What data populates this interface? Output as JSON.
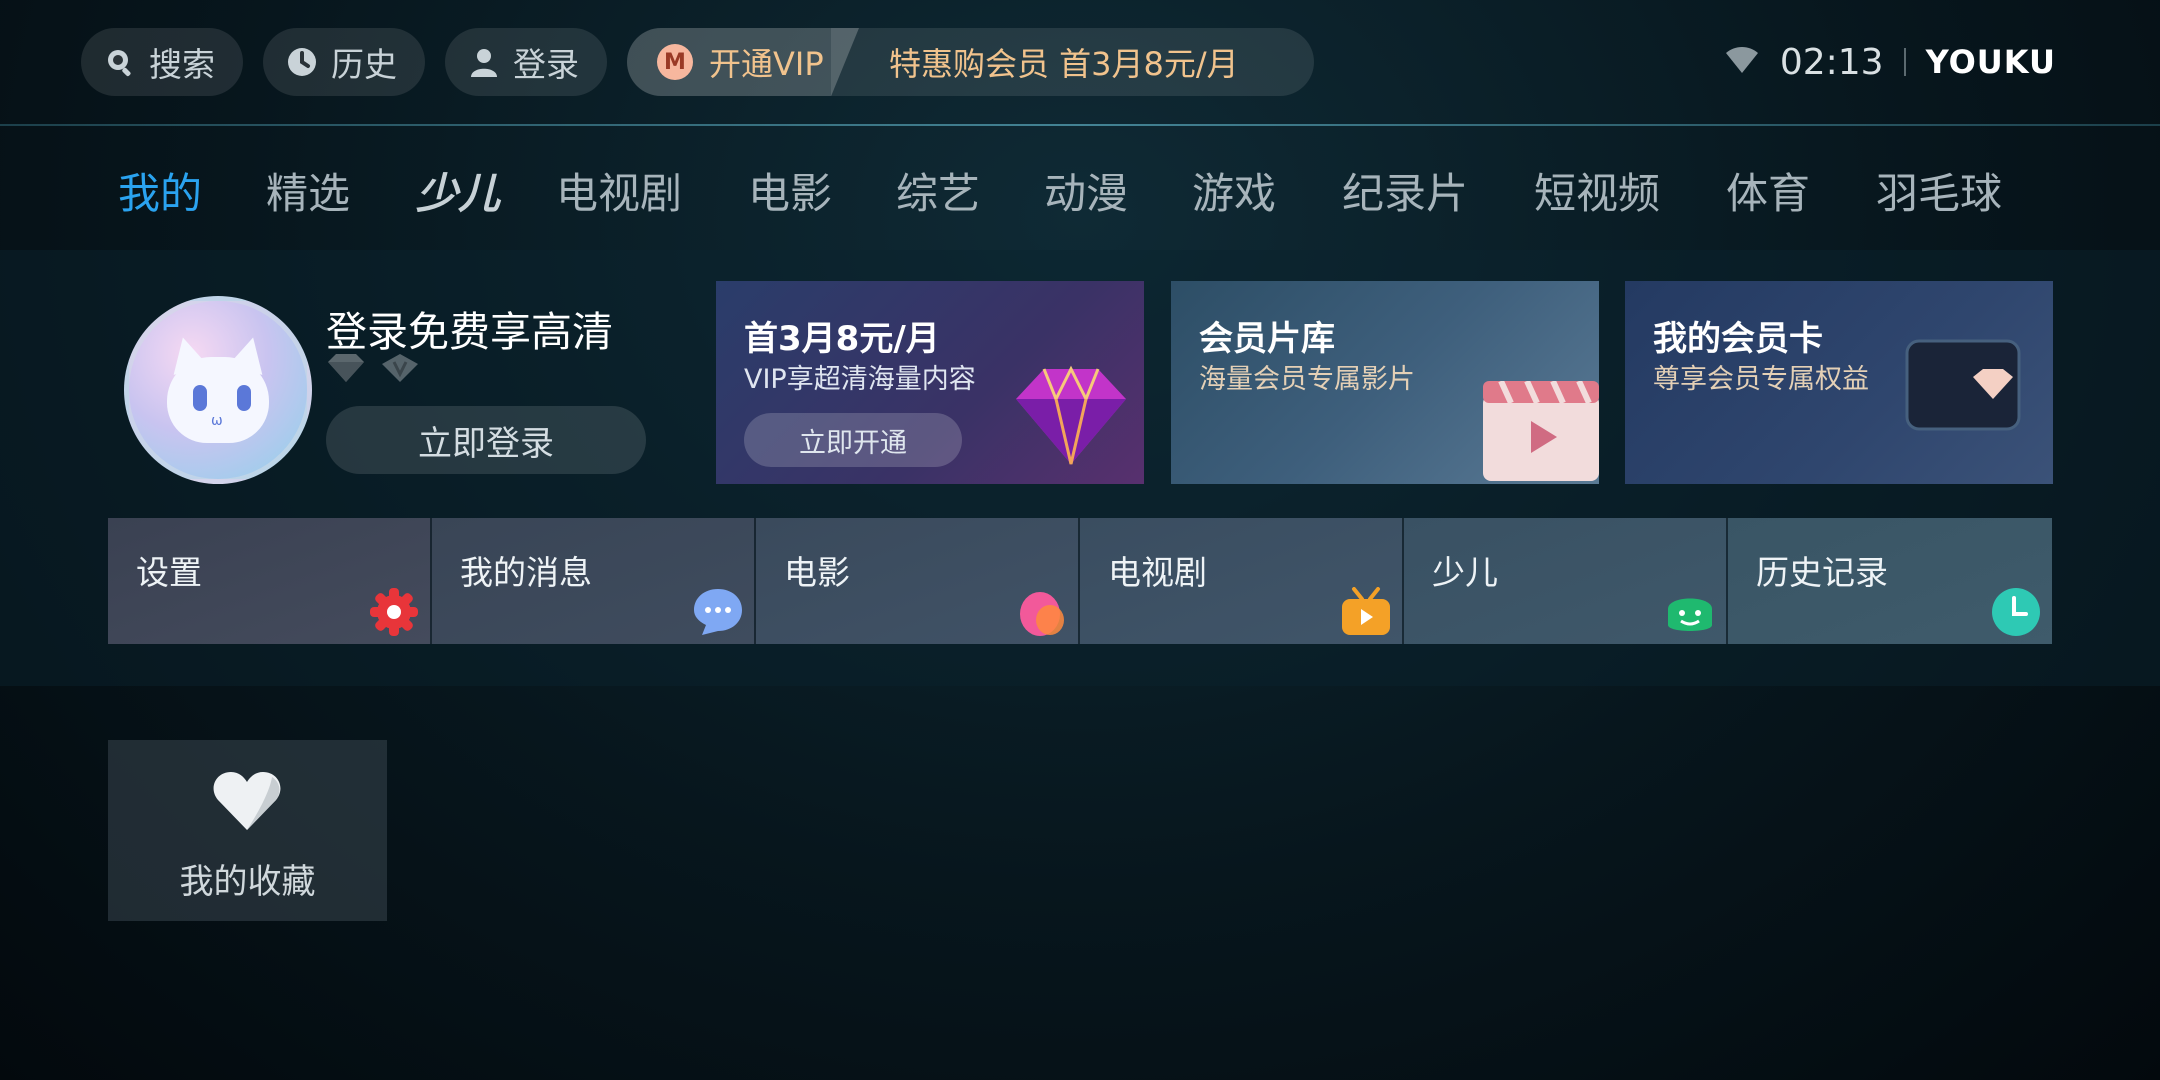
{
  "topbar": {
    "search_label": "搜索",
    "history_label": "历史",
    "login_label": "登录",
    "vip_open_label": "开通VIP",
    "vip_offer_label": "特惠购会员 首3月8元/月",
    "clock": "02:13",
    "brand": "YOUKU"
  },
  "nav": {
    "tabs": [
      {
        "label": "我的",
        "active": true
      },
      {
        "label": "精选"
      },
      {
        "label": "少儿"
      },
      {
        "label": "电视剧"
      },
      {
        "label": "电影"
      },
      {
        "label": "综艺"
      },
      {
        "label": "动漫"
      },
      {
        "label": "游戏"
      },
      {
        "label": "纪录片"
      },
      {
        "label": "短视频"
      },
      {
        "label": "体育"
      },
      {
        "label": "羽毛球"
      }
    ]
  },
  "profile": {
    "title": "登录免费享高清",
    "login_button": "立即登录"
  },
  "cards": [
    {
      "title": "首3月8元/月",
      "subtitle": "VIP享超清海量内容",
      "button": "立即开通"
    },
    {
      "title": "会员片库",
      "subtitle": "海量会员专属影片"
    },
    {
      "title": "我的会员卡",
      "subtitle": "尊享会员专属权益"
    }
  ],
  "shortcuts": [
    {
      "label": "设置",
      "icon": "gear-icon",
      "color": "#e8353a"
    },
    {
      "label": "我的消息",
      "icon": "chat-bubble-icon",
      "color": "#7fa8f3"
    },
    {
      "label": "电影",
      "icon": "movie-blob-icon",
      "color": "#f2599a"
    },
    {
      "label": "电视剧",
      "icon": "tv-icon",
      "color": "#f4a127"
    },
    {
      "label": "少儿",
      "icon": "smiley-icon",
      "color": "#1fb96f"
    },
    {
      "label": "历史记录",
      "icon": "clock-icon",
      "color": "#2ec9b4"
    }
  ],
  "favorites": {
    "label": "我的收藏",
    "icon": "heart-icon"
  }
}
